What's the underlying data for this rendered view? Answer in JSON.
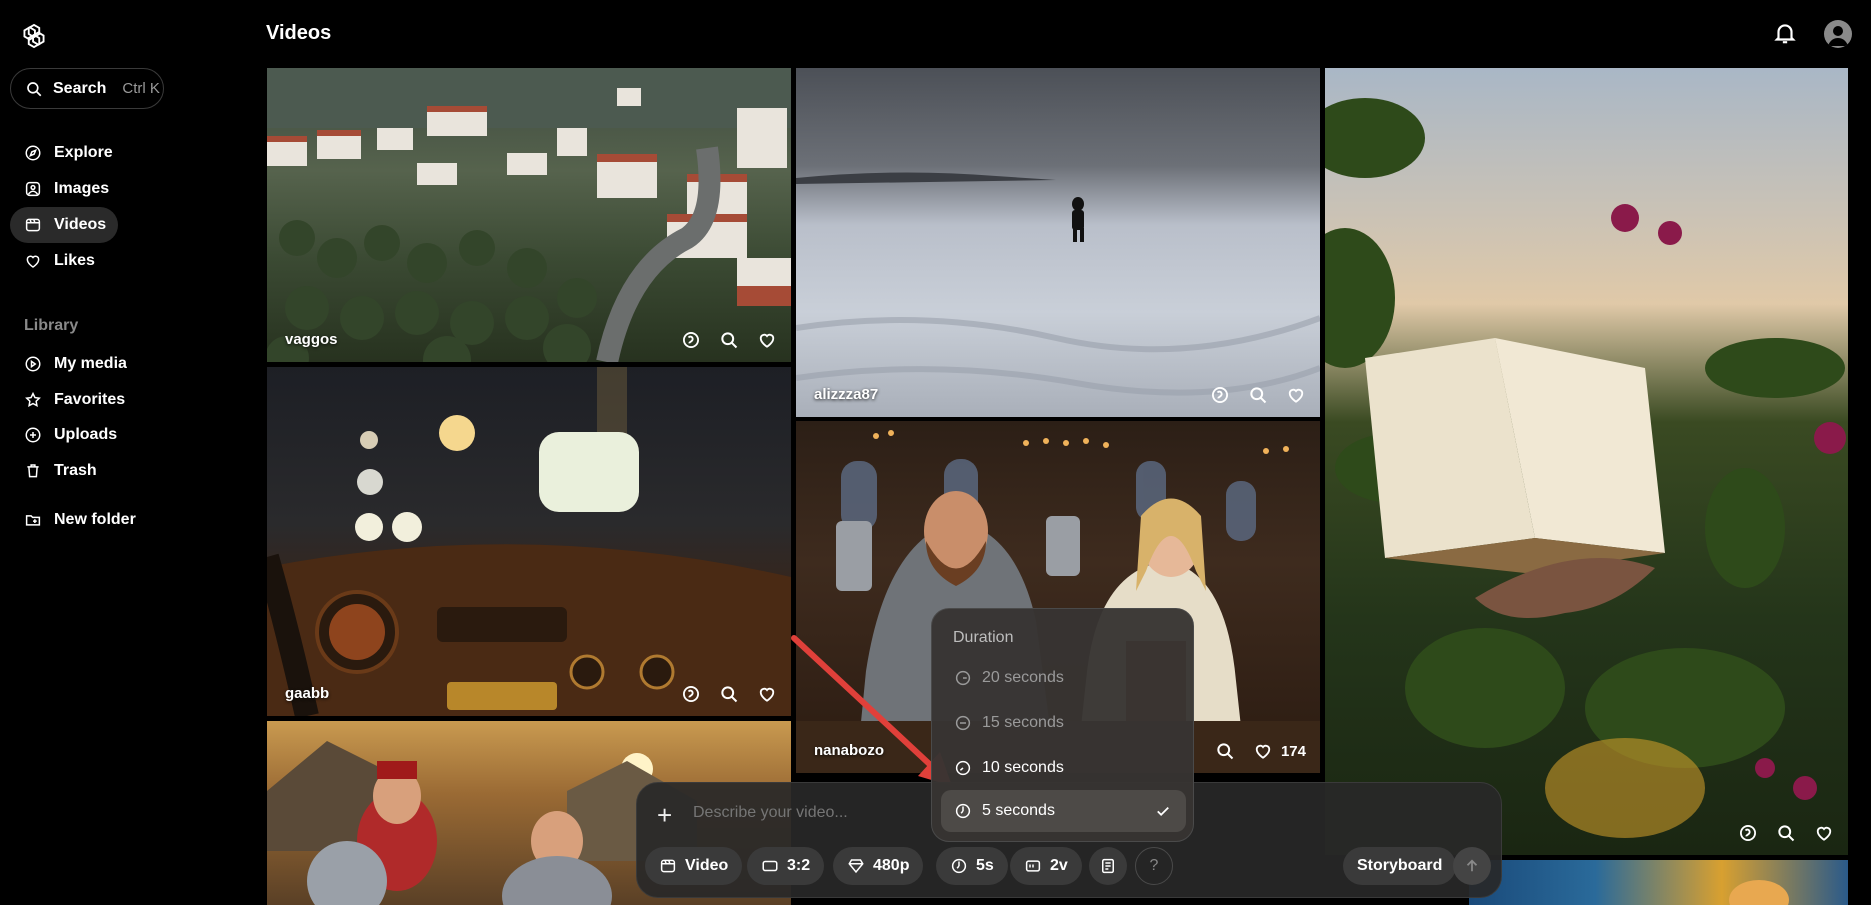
{
  "app": {
    "page_title": "Videos"
  },
  "search": {
    "label": "Search",
    "shortcut": "Ctrl K"
  },
  "nav": {
    "items": [
      {
        "label": "Explore",
        "icon": "compass-icon"
      },
      {
        "label": "Images",
        "icon": "image-icon"
      },
      {
        "label": "Videos",
        "icon": "video-icon",
        "active": true
      },
      {
        "label": "Likes",
        "icon": "heart-icon"
      }
    ],
    "library_label": "Library",
    "library_items": [
      {
        "label": "My media",
        "icon": "media-icon"
      },
      {
        "label": "Favorites",
        "icon": "star-icon"
      },
      {
        "label": "Uploads",
        "icon": "upload-icon"
      },
      {
        "label": "Trash",
        "icon": "trash-icon"
      }
    ],
    "new_folder": "New folder"
  },
  "tiles": [
    {
      "user": "vaggos"
    },
    {
      "user": "alizzza87"
    },
    {
      "user": "gaabb"
    },
    {
      "user": "nanabozo",
      "likes": "174"
    }
  ],
  "composer": {
    "placeholder": "Describe your video...",
    "type": "Video",
    "aspect": "3:2",
    "resolution": "480p",
    "duration": "5s",
    "variations": "2v",
    "help": "?",
    "storyboard": "Storyboard"
  },
  "duration_popup": {
    "title": "Duration",
    "options": [
      "20 seconds",
      "15 seconds",
      "10 seconds",
      "5 seconds"
    ],
    "selected": "5 seconds"
  },
  "colors": {
    "accent_arrow": "#e0403a",
    "background": "#000000"
  }
}
